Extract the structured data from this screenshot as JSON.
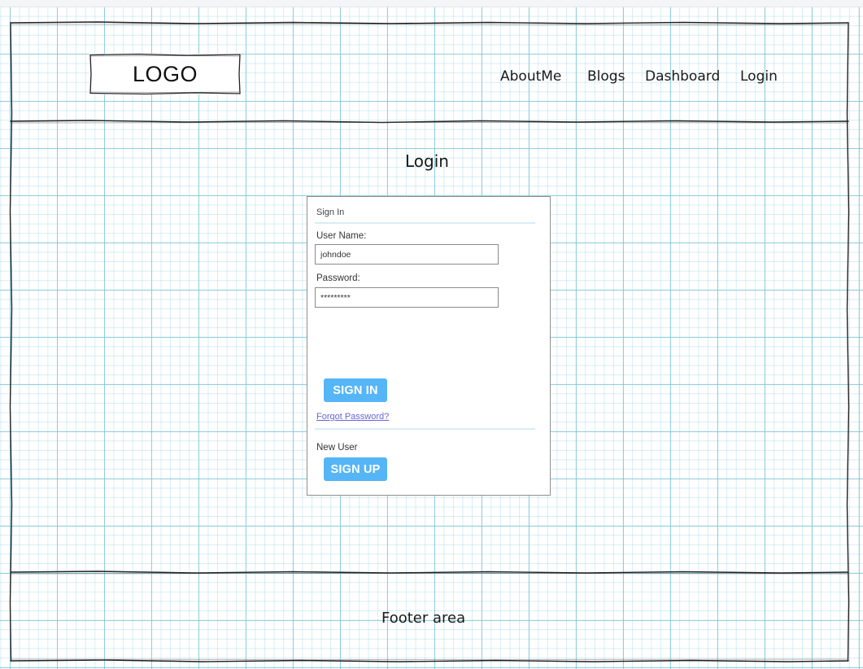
{
  "logo": {
    "text": "LOGO"
  },
  "nav": {
    "items": [
      {
        "label": "AboutMe"
      },
      {
        "label": "Blogs"
      },
      {
        "label": "Dashboard"
      },
      {
        "label": "Login"
      }
    ]
  },
  "main": {
    "title": "Login"
  },
  "login_panel": {
    "header": "Sign In",
    "username": {
      "label": "User Name:",
      "value": "johndoe"
    },
    "password": {
      "label": "Password:",
      "value": "*********"
    },
    "sign_in_label": "SIGN IN",
    "forgot_password": "Forgot Password?",
    "new_user_label": "New User",
    "sign_up_label": "SIGN UP"
  },
  "footer": {
    "text": "Footer area"
  },
  "colors": {
    "grid": "#78c3d7",
    "button": "#55b5f7",
    "link": "#6b63d8",
    "sketch_line": "#222222"
  }
}
